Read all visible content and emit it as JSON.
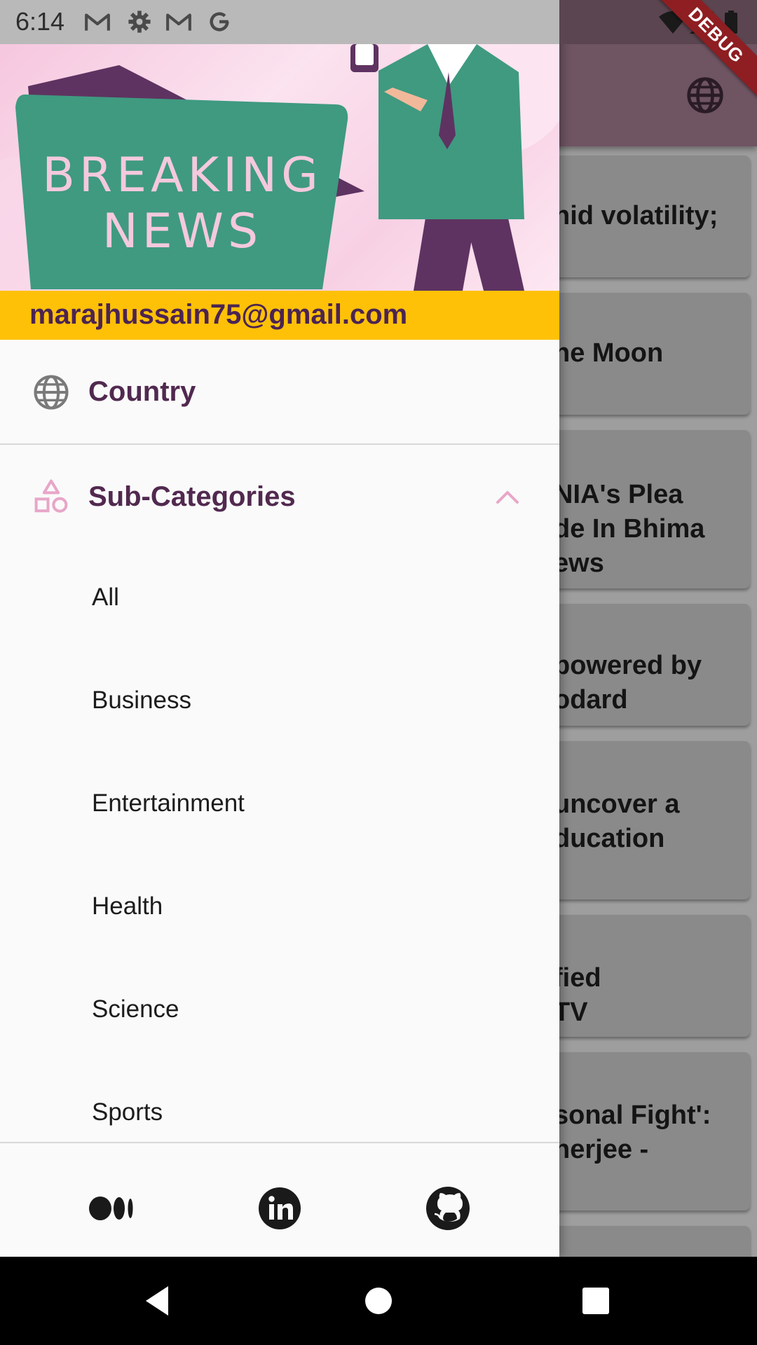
{
  "status_bar": {
    "time": "6:14",
    "notification_icons": [
      "gmail-icon",
      "settings-icon",
      "gmail-icon",
      "google-icon"
    ],
    "system_icons": [
      "wifi-icon",
      "signal-icon",
      "battery-icon"
    ]
  },
  "debug_banner": "DEBUG",
  "background_feed": {
    "app_bar_color": "#6f5462",
    "cards": [
      {
        "text": "nid volatility;"
      },
      {
        "text": "he Moon"
      },
      {
        "text": "NIA's Plea\nde In Bhima\news"
      },
      {
        "text": "powered by\nodard"
      },
      {
        "text": "uncover a\nducation"
      },
      {
        "text": "fied\nTV"
      },
      {
        "text": "sonal Fight':\nnerjee -"
      }
    ]
  },
  "drawer": {
    "header_image_text": {
      "line1": "BREAKING",
      "line2": "NEWS"
    },
    "email": "marajhussain75@gmail.com",
    "country_label": "Country",
    "subcategories_label": "Sub-Categories",
    "subcategories": [
      "All",
      "Business",
      "Entertainment",
      "Health",
      "Science",
      "Sports"
    ],
    "footer_links": [
      "medium-icon",
      "linkedin-icon",
      "github-icon"
    ]
  },
  "colors": {
    "accent": "#ffc107",
    "primary_text": "#51294f",
    "subcategory_icon": "#e8a6c8"
  },
  "nav_bar": [
    "back-icon",
    "home-icon",
    "recents-icon"
  ]
}
